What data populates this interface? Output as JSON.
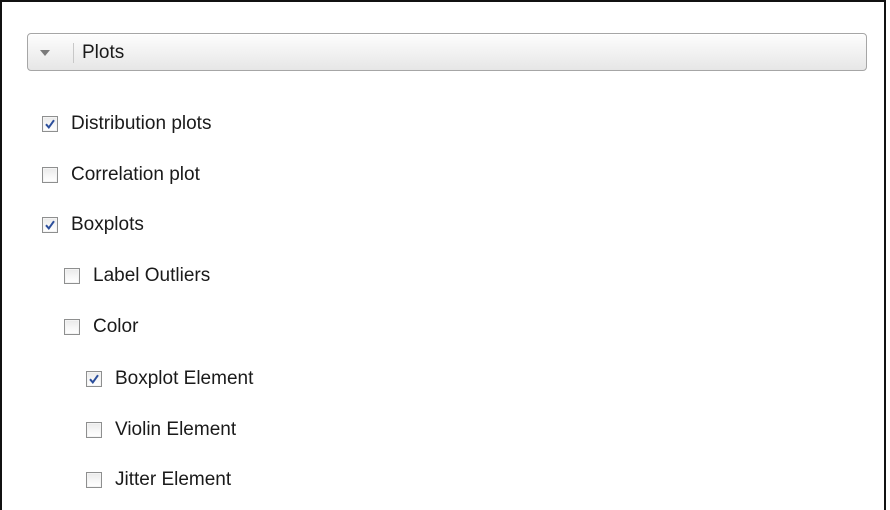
{
  "section": {
    "title": "Plots",
    "expander_icon": "triangle-down-icon"
  },
  "options": {
    "distribution_plots": {
      "label": "Distribution plots",
      "checked": true
    },
    "correlation_plot": {
      "label": "Correlation plot",
      "checked": false
    },
    "boxplots": {
      "label": "Boxplots",
      "checked": true
    },
    "label_outliers": {
      "label": "Label Outliers",
      "checked": false
    },
    "color": {
      "label": "Color",
      "checked": false
    },
    "boxplot_element": {
      "label": "Boxplot Element",
      "checked": true
    },
    "violin_element": {
      "label": "Violin Element",
      "checked": false
    },
    "jitter_element": {
      "label": "Jitter Element",
      "checked": false
    }
  },
  "colors": {
    "check_mark": "#2b4e9b",
    "border": "#111111",
    "text": "#1a1a1a"
  }
}
